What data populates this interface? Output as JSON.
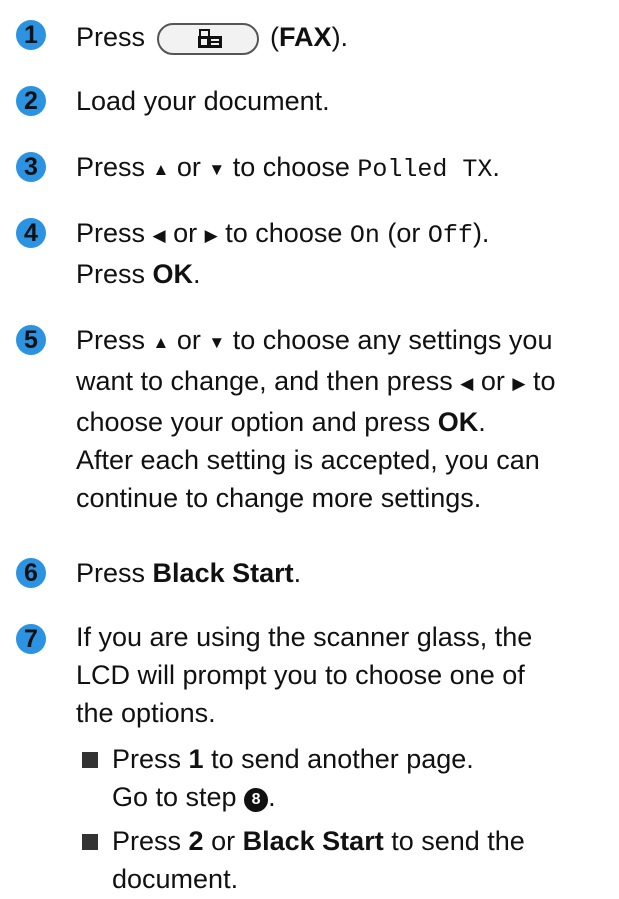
{
  "steps": [
    {
      "num": "1",
      "press": "Press",
      "key_name": "FAX",
      "paren_open": " (",
      "paren_close": ")."
    },
    {
      "num": "2",
      "text": "Load your document."
    },
    {
      "num": "3",
      "press": "Press",
      "or": "or",
      "to_choose": "to choose",
      "option": "Polled TX",
      "end": "."
    },
    {
      "num": "4",
      "press": "Press",
      "or": "or",
      "to_choose": "to choose",
      "on": "On",
      "or_open": "(or",
      "off": "Off",
      "close": ").",
      "press2": "Press",
      "ok": "OK",
      "end": "."
    },
    {
      "num": "5",
      "press": "Press",
      "or": "or",
      "line1_rest": "to choose any settings you",
      "line2_a": "want to change, and then press",
      "or2": "or",
      "to": "to",
      "line3_a": "choose your option and press",
      "ok": "OK",
      "end": ".",
      "line4": "After each setting is accepted, you can",
      "line5": "continue to change more settings."
    },
    {
      "num": "6",
      "press": "Press",
      "key": "Black Start",
      "end": "."
    },
    {
      "num": "7",
      "line1": "If you are using the scanner glass, the",
      "line2": "LCD will prompt you to choose one of",
      "line3": "the options."
    }
  ],
  "bullets": [
    {
      "press": "Press",
      "key": "1",
      "rest": "to send another page.",
      "line2": "Go to step",
      "ref": "8",
      "end": "."
    },
    {
      "press": "Press",
      "key": "2",
      "or": "or",
      "key2": "Black Start",
      "rest": "to send the",
      "line2": "document."
    }
  ],
  "symbols": {
    "up": "▲",
    "down": "▼",
    "left": "◀",
    "right": "▶"
  },
  "colors": {
    "step_number": "#2b93e2",
    "text": "#111111"
  }
}
